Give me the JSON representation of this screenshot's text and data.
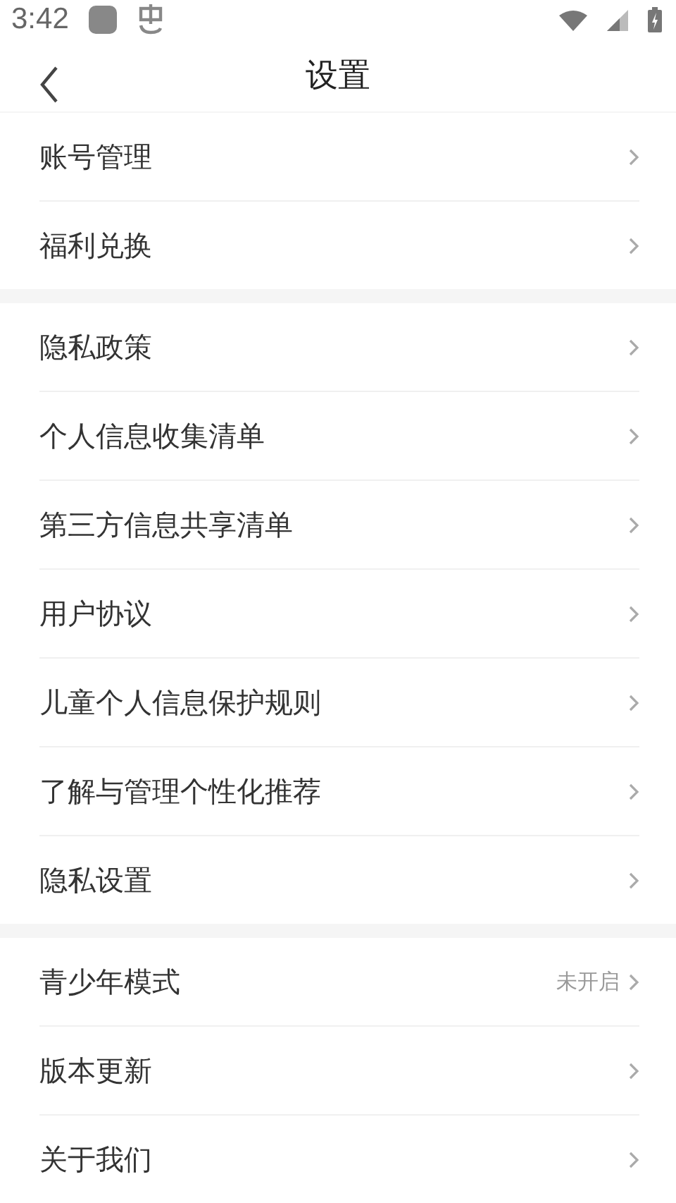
{
  "status_bar": {
    "time": "3:42"
  },
  "header": {
    "title": "设置"
  },
  "groups": [
    {
      "items": [
        {
          "label": "账号管理"
        },
        {
          "label": "福利兑换"
        }
      ]
    },
    {
      "items": [
        {
          "label": "隐私政策"
        },
        {
          "label": "个人信息收集清单"
        },
        {
          "label": "第三方信息共享清单"
        },
        {
          "label": "用户协议"
        },
        {
          "label": "儿童个人信息保护规则"
        },
        {
          "label": "了解与管理个性化推荐"
        },
        {
          "label": "隐私设置"
        }
      ]
    },
    {
      "items": [
        {
          "label": "青少年模式",
          "value": "未开启"
        },
        {
          "label": "版本更新"
        },
        {
          "label": "关于我们"
        }
      ]
    }
  ]
}
